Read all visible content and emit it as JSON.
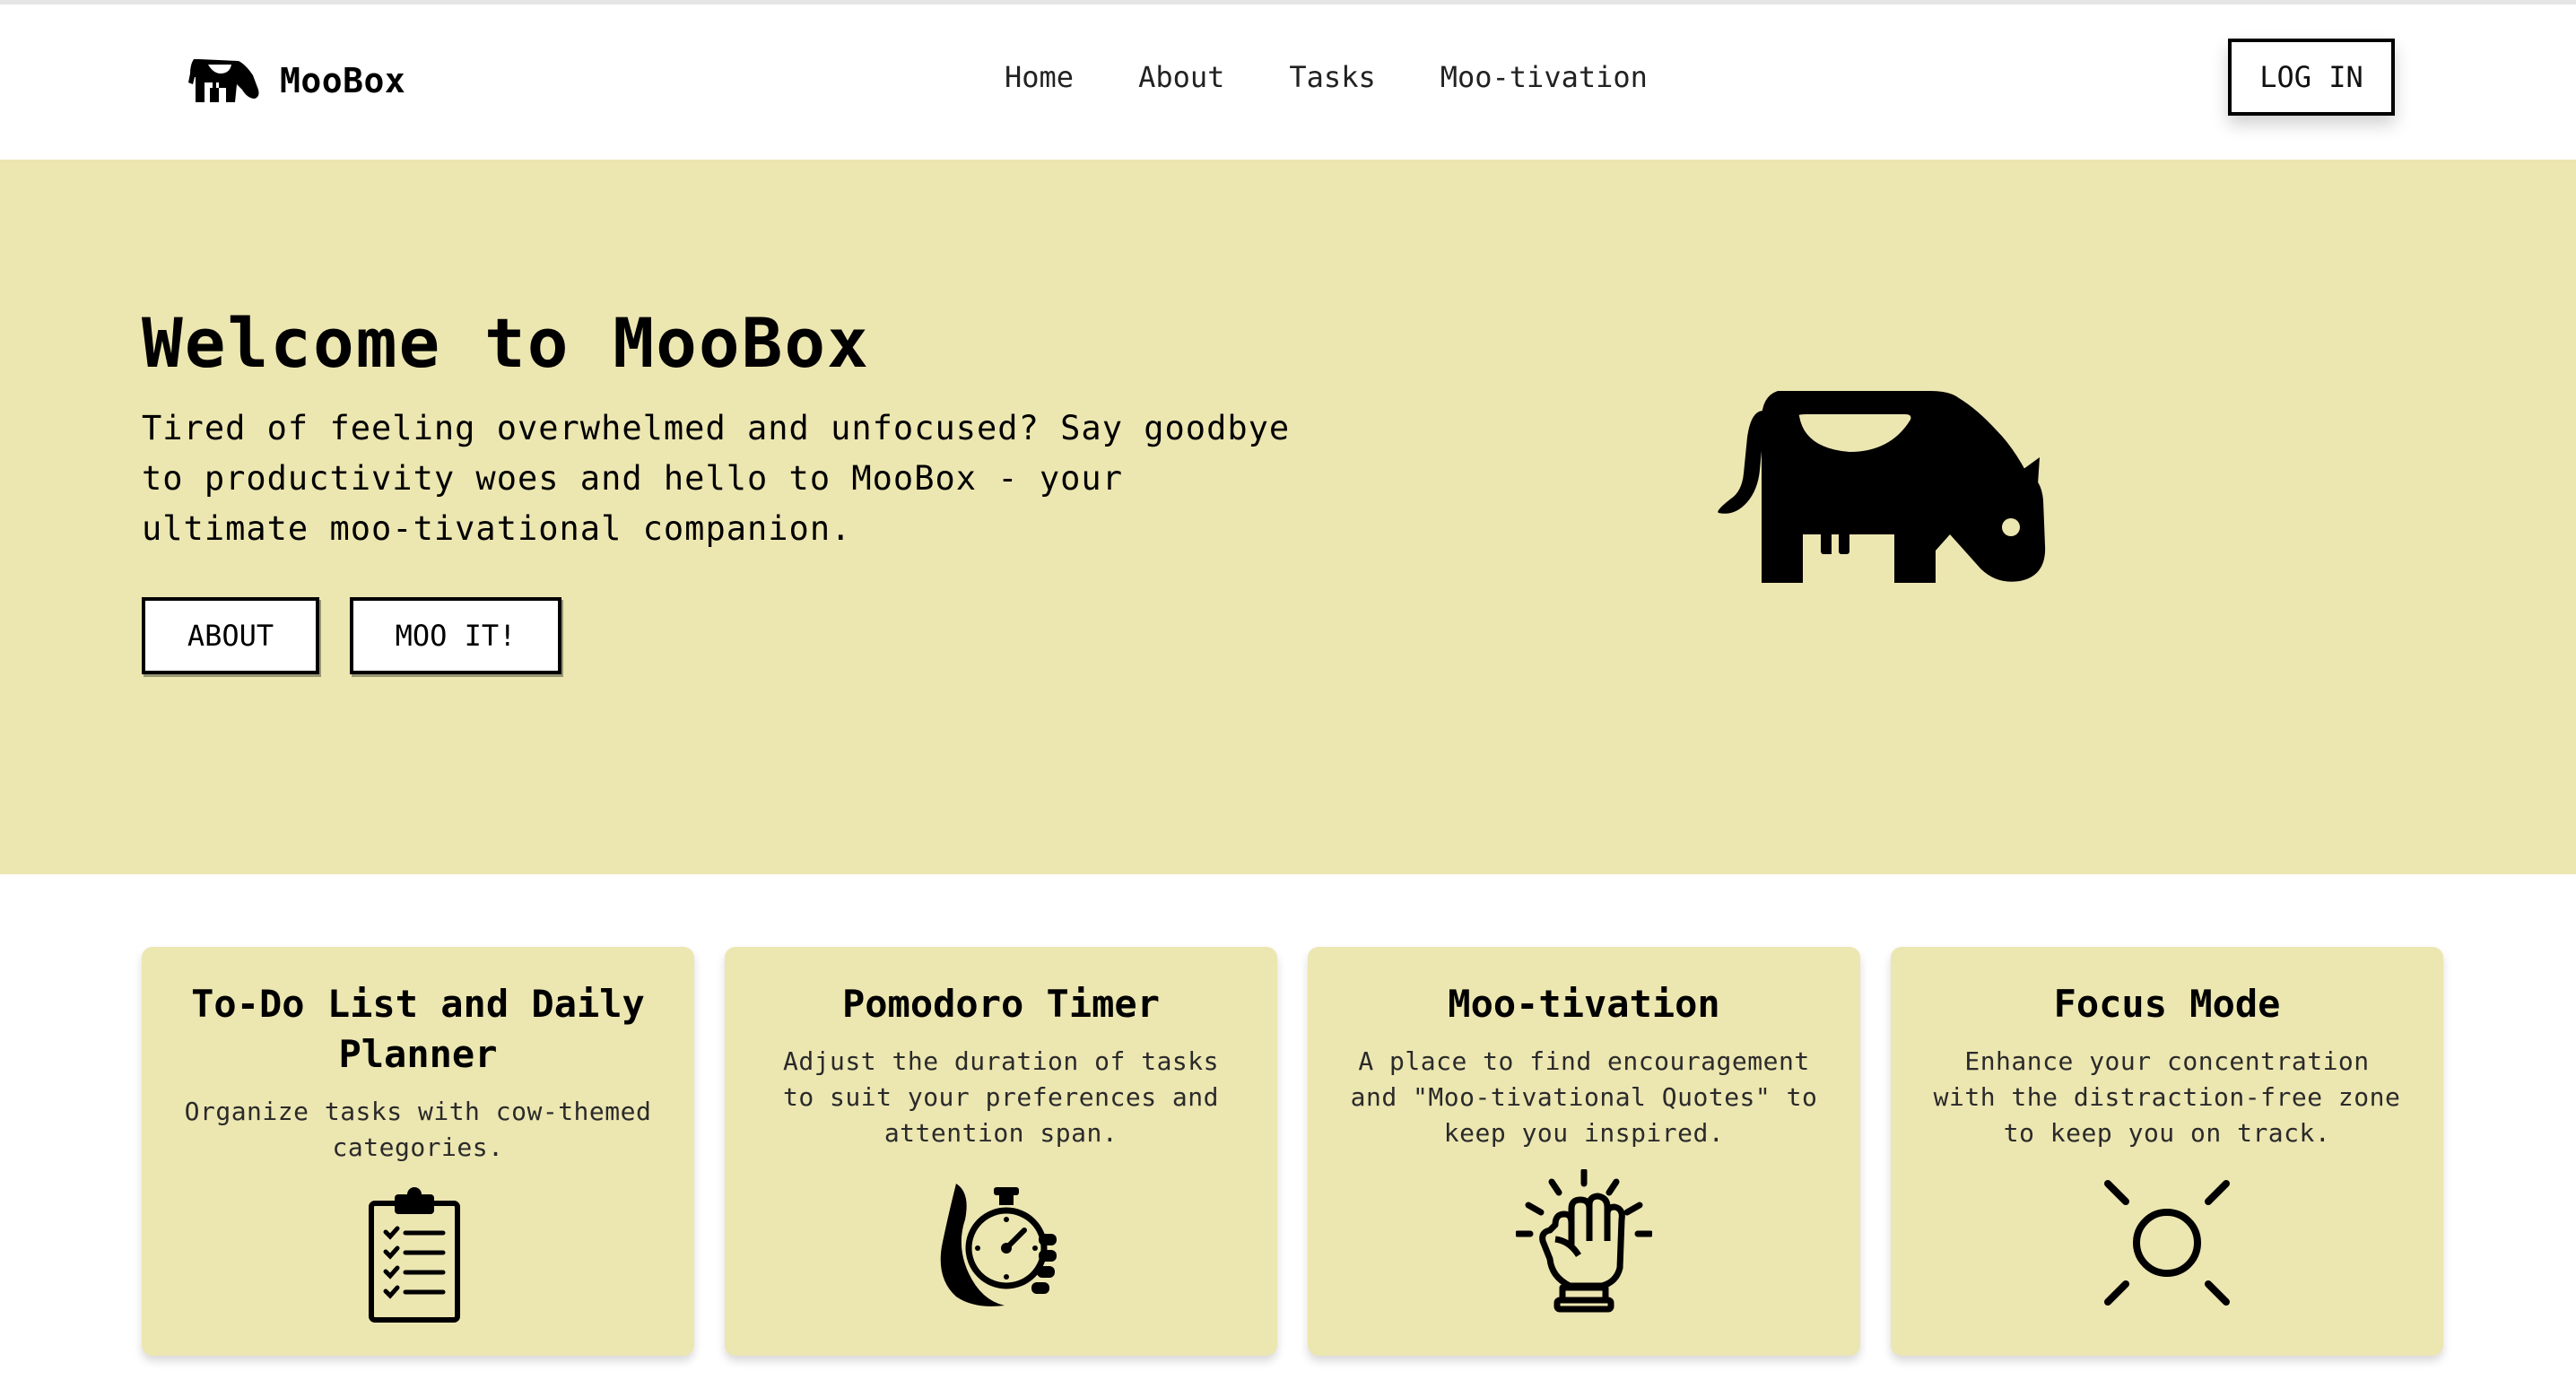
{
  "nav": {
    "brand": "MooBox",
    "links": [
      "Home",
      "About",
      "Tasks",
      "Moo-tivation"
    ],
    "login_label": "LOG IN"
  },
  "hero": {
    "title": "Welcome to MooBox",
    "text": "Tired of feeling overwhelmed and unfocused? Say goodbye to productivity woes and hello to MooBox - your ultimate moo-tivational companion.",
    "about_label": "ABOUT",
    "moo_label": "MOO IT!"
  },
  "cards": [
    {
      "title": "To-Do List and Daily Planner",
      "desc": "Organize tasks with cow-themed categories.",
      "icon": "clipboard-checklist-icon"
    },
    {
      "title": "Pomodoro Timer",
      "desc": "Adjust the duration of tasks to suit your preferences and attention span.",
      "icon": "stopwatch-hand-icon"
    },
    {
      "title": "Moo-tivation",
      "desc": "A place to find encouragement and \"Moo-tivational Quotes\" to keep you inspired.",
      "icon": "raised-fist-icon"
    },
    {
      "title": "Focus Mode",
      "desc": "Enhance your concentration with the distraction-free zone to keep you on track.",
      "icon": "sun-focus-icon"
    }
  ],
  "colors": {
    "hero_bg": "#ece6b1",
    "card_bg": "#ece6b1",
    "text": "#000000"
  }
}
